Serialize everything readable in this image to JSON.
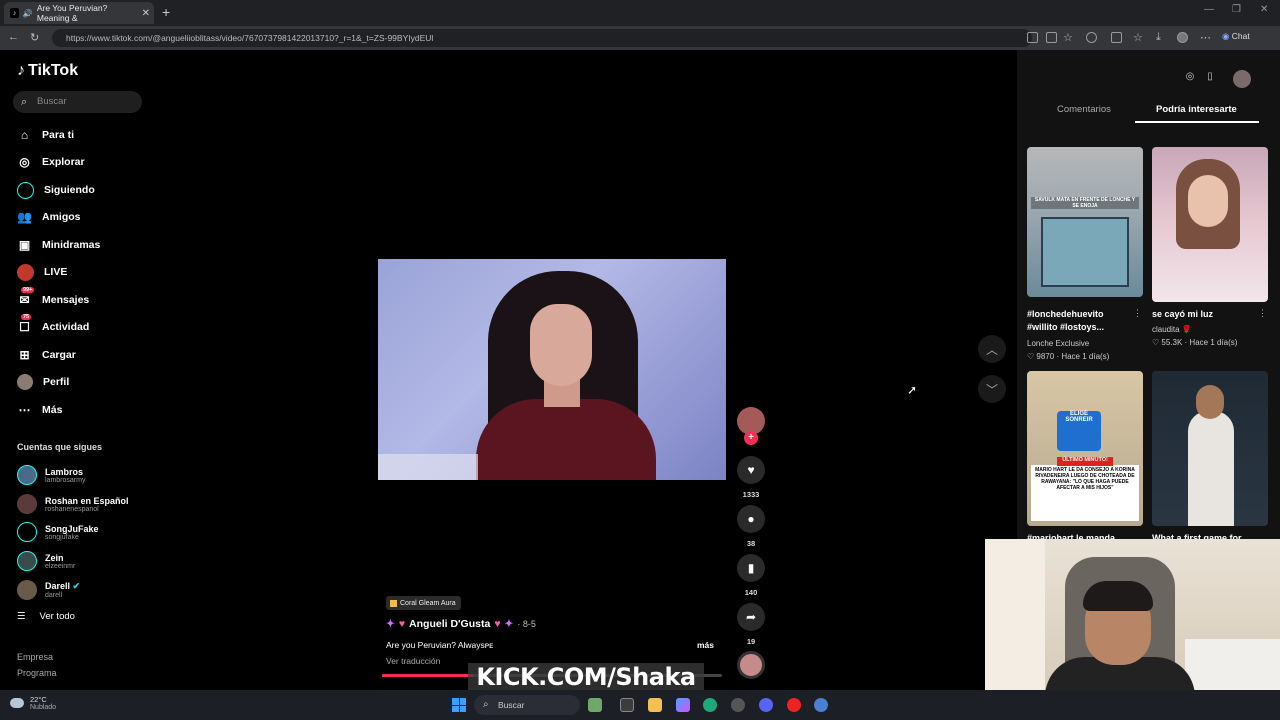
{
  "browser": {
    "tab_title": "Are You Peruvian? Meaning &",
    "url": "https://www.tiktok.com/@angueliioblitass/video/7670737981422013710?_r=1&_t=ZS-99BYIydEUl",
    "chat_label": "Chat"
  },
  "logo": "TikTok",
  "search_placeholder": "Buscar",
  "nav": [
    {
      "label": "Para ti",
      "icon": "home-icon"
    },
    {
      "label": "Explorar",
      "icon": "compass-icon"
    },
    {
      "label": "Siguiendo",
      "icon": "following-icon"
    },
    {
      "label": "Amigos",
      "icon": "friends-icon"
    },
    {
      "label": "Minidramas",
      "icon": "minidramas-icon"
    },
    {
      "label": "LIVE",
      "icon": "live-icon"
    },
    {
      "label": "Mensajes",
      "icon": "messages-icon",
      "badge": "99+"
    },
    {
      "label": "Actividad",
      "icon": "activity-icon",
      "badge": "75"
    },
    {
      "label": "Cargar",
      "icon": "upload-icon"
    },
    {
      "label": "Perfil",
      "icon": "profile-icon"
    },
    {
      "label": "Más",
      "icon": "more-icon"
    }
  ],
  "following_title": "Cuentas que sigues",
  "following": [
    {
      "name": "Lambros",
      "user": "lambrosarmy"
    },
    {
      "name": "Roshan en Español",
      "user": "roshanenespanol"
    },
    {
      "name": "SongJuFake",
      "user": "songjufake"
    },
    {
      "name": "Zein",
      "user": "elzeeinmr"
    },
    {
      "name": "Darell",
      "user": "darell"
    }
  ],
  "ver_todo": "Ver todo",
  "footer": [
    "Empresa",
    "Programa"
  ],
  "video": {
    "effect_label": "Coral Gleam Aura",
    "author": "Angueli D'Gusta",
    "date": "· 8-5",
    "description": "Are you Peruvian? Alwaysᴘᴇ",
    "more": "más",
    "translate": "Ver traducción",
    "progress": 0.27,
    "watermark": "KICK.COM/Shaka"
  },
  "actions": {
    "likes": "1333",
    "comments": "38",
    "saves": "140",
    "shares": "19"
  },
  "right_panel": {
    "tab_comments": "Comentarios",
    "tab_suggested": "Podría interesarte",
    "cards": [
      {
        "title": "#lonchedehuevito #willito #lostoys...",
        "author": "Lonche Exclusive",
        "likes": "9870",
        "time": "· Hace 1 día(s)",
        "thumb_text": "SAVULK MATA EN FRENTE DE LONCHE Y SE ENOJA"
      },
      {
        "title": "se cayó mi luz",
        "author": "claudita 🌹",
        "likes": "55.3K",
        "time": "· Hace 1 día(s)"
      },
      {
        "title": "#mariohart le manda...",
        "thumb_text_top": "ELIGE SONREIR",
        "thumb_badge": "ÚLTIMO MINUTO!",
        "thumb_text": "MARIO HART LE DA CONSEJO A KORINA RIVADENEIRA LUEGO DE CHOTEADA DE RAWAYANA: \"LO QUE HAGA PUEDE AFECTAR A MIS HIJOS\""
      },
      {
        "title": "What a first game for..."
      }
    ]
  },
  "taskbar": {
    "weather_temp": "22°C",
    "weather_desc": "Nublado",
    "search": "Buscar"
  }
}
